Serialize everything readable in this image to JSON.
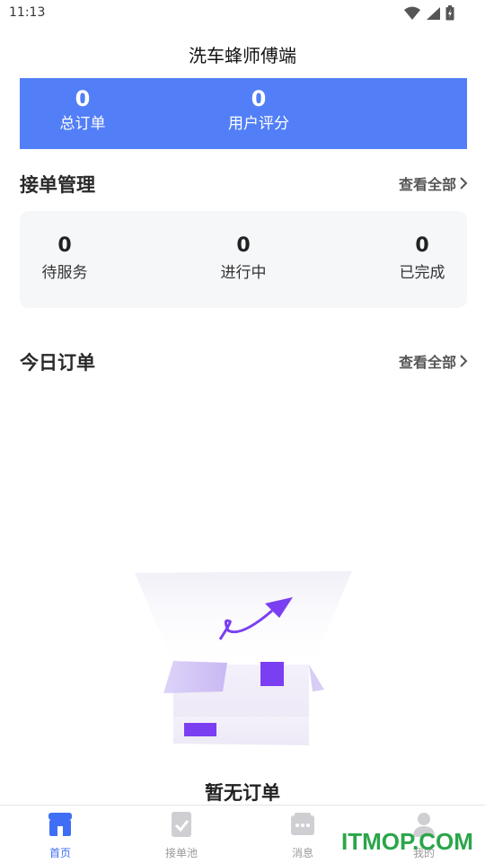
{
  "status_bar": {
    "time": "11:13"
  },
  "header": {
    "title": "洗车蜂师傅端"
  },
  "stats": {
    "total_orders": {
      "value": "0",
      "label": "总订单"
    },
    "user_rating": {
      "value": "0",
      "label": "用户评分"
    }
  },
  "order_management": {
    "title": "接单管理",
    "view_all": "查看全部",
    "items": [
      {
        "value": "0",
        "label": "待服务"
      },
      {
        "value": "0",
        "label": "进行中"
      },
      {
        "value": "0",
        "label": "已完成"
      }
    ]
  },
  "today_orders": {
    "title": "今日订单",
    "view_all": "查看全部",
    "empty_text": "暂无订单"
  },
  "tab_bar": {
    "items": [
      {
        "label": "首页",
        "icon": "store-icon",
        "active": true
      },
      {
        "label": "接单池",
        "icon": "clipboard-check-icon",
        "active": false
      },
      {
        "label": "消息",
        "icon": "message-icon",
        "active": false
      },
      {
        "label": "我的",
        "icon": "user-icon",
        "active": false
      }
    ]
  },
  "watermark": "ITMOP.COM",
  "colors": {
    "accent": "#527ff7",
    "tab_active": "#3f6ef5",
    "illustration": "#7b3ff2"
  }
}
